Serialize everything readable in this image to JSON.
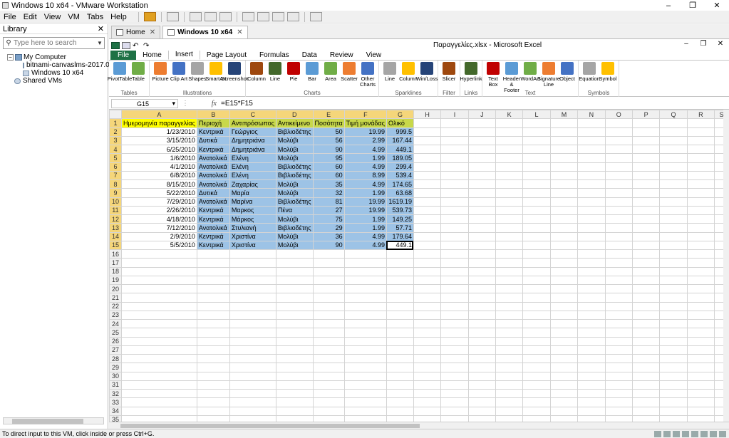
{
  "window": {
    "title": "Windows 10 x64 - VMware Workstation"
  },
  "menu": [
    "File",
    "Edit",
    "View",
    "VM",
    "Tabs",
    "Help"
  ],
  "library": {
    "title": "Library",
    "search_placeholder": "Type here to search",
    "tree": {
      "root": "My Computer",
      "children": [
        "bitnami-canvaslms-2017.04.22.1",
        "Windows 10 x64"
      ],
      "shared": "Shared VMs"
    }
  },
  "vm_tabs": [
    {
      "label": "Home"
    },
    {
      "label": "Windows 10 x64"
    }
  ],
  "excel": {
    "doc_title": "Παραγγελίες.xlsx - Microsoft Excel",
    "ribbon_tabs": [
      "File",
      "Home",
      "Insert",
      "Page Layout",
      "Formulas",
      "Data",
      "Review",
      "View"
    ],
    "ribbon_groups": [
      {
        "label": "Tables",
        "buttons": [
          "PivotTable",
          "Table"
        ]
      },
      {
        "label": "Illustrations",
        "buttons": [
          "Picture",
          "Clip Art",
          "Shapes",
          "SmartArt",
          "Screenshot"
        ]
      },
      {
        "label": "Charts",
        "buttons": [
          "Column",
          "Line",
          "Pie",
          "Bar",
          "Area",
          "Scatter",
          "Other Charts"
        ]
      },
      {
        "label": "Sparklines",
        "buttons": [
          "Line",
          "Column",
          "Win/Loss"
        ]
      },
      {
        "label": "Filter",
        "buttons": [
          "Slicer"
        ]
      },
      {
        "label": "Links",
        "buttons": [
          "Hyperlink"
        ]
      },
      {
        "label": "Text",
        "buttons": [
          "Text Box",
          "Header & Footer",
          "WordArt",
          "Signature Line",
          "Object"
        ]
      },
      {
        "label": "Symbols",
        "buttons": [
          "Equation",
          "Symbol"
        ]
      }
    ],
    "name_box": "G15",
    "fx_label": "fx",
    "formula": "=E15*F15",
    "columns": [
      "A",
      "B",
      "C",
      "D",
      "E",
      "F",
      "G",
      "H",
      "I",
      "J",
      "K",
      "L",
      "M",
      "N",
      "O",
      "P",
      "Q",
      "R",
      "S"
    ],
    "headers": [
      "Ημερομηνία παραγγελίας",
      "Περιοχή",
      "Αντιπρόσωπος",
      "Αντικείμενο",
      "Ποσότητα",
      "Τιμή μονάδας",
      "Ολικό"
    ],
    "rows": [
      [
        "1/23/2010",
        "Κεντρικά",
        "Γεώργιος",
        "Βιβλιοδέτης",
        "50",
        "19.99",
        "999.5"
      ],
      [
        "3/15/2010",
        "Δυτικά",
        "Δημητριάνα",
        "Μολύβι",
        "56",
        "2.99",
        "167.44"
      ],
      [
        "6/25/2010",
        "Κεντρικά",
        "Δημητριάνα",
        "Μολύβι",
        "90",
        "4.99",
        "449.1"
      ],
      [
        "1/6/2010",
        "Ανατολικά",
        "Ελένη",
        "Μολύβι",
        "95",
        "1.99",
        "189.05"
      ],
      [
        "4/1/2010",
        "Ανατολικά",
        "Ελένη",
        "Βιβλιοδέτης",
        "60",
        "4.99",
        "299.4"
      ],
      [
        "6/8/2010",
        "Ανατολικά",
        "Ελένη",
        "Βιβλιοδέτης",
        "60",
        "8.99",
        "539.4"
      ],
      [
        "8/15/2010",
        "Ανατολικά",
        "Ζαχαρίας",
        "Μολύβι",
        "35",
        "4.99",
        "174.65"
      ],
      [
        "5/22/2010",
        "Δυτικά",
        "Μαρία",
        "Μολύβι",
        "32",
        "1.99",
        "63.68"
      ],
      [
        "7/29/2010",
        "Ανατολικά",
        "Μαρίνα",
        "Βιβλιοδέτης",
        "81",
        "19.99",
        "1619.19"
      ],
      [
        "2/26/2010",
        "Κεντρικά",
        "Μαρκος",
        "Πένα",
        "27",
        "19.99",
        "539.73"
      ],
      [
        "4/18/2010",
        "Κεντρικά",
        "Μάρκος",
        "Μολύβι",
        "75",
        "1.99",
        "149.25"
      ],
      [
        "7/12/2010",
        "Ανατολικά",
        "Στυλιανή",
        "Βιβλιοδέτης",
        "29",
        "1.99",
        "57.71"
      ],
      [
        "2/9/2010",
        "Κεντρικά",
        "Χριστίνα",
        "Μολύβι",
        "36",
        "4.99",
        "179.64"
      ],
      [
        "5/5/2010",
        "Κεντρικά",
        "Χριστίνα",
        "Μολύβι",
        "90",
        "4.99",
        "449.1"
      ]
    ],
    "total_rows": 35
  },
  "status": {
    "text": "To direct input to this VM, click inside or press Ctrl+G."
  },
  "colors": {
    "excel_green": "#1e7145",
    "header_fill": "#c8d84a",
    "selection": "#9dc3e6",
    "colA_header": "#ffff00"
  }
}
